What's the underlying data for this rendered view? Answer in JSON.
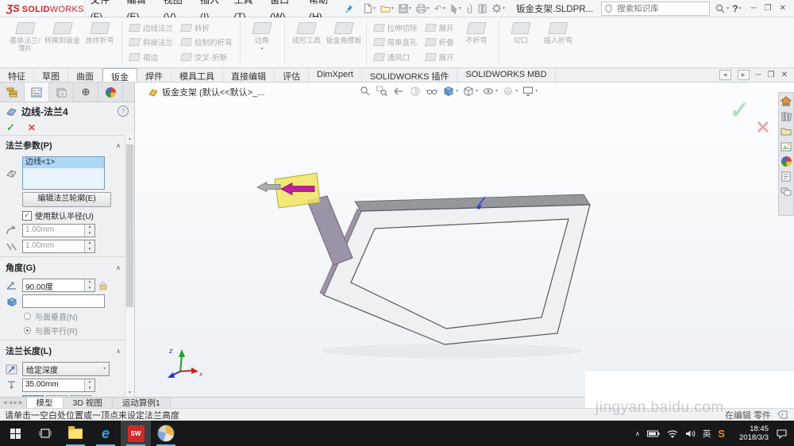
{
  "titlebar": {
    "logo_mark": "ƷS",
    "logo_solid": "SOLID",
    "logo_works": "WORKS",
    "menus": [
      "文件(F)",
      "编辑(E)",
      "视图(V)",
      "插入(I)",
      "工具(T)",
      "窗口(W)",
      "帮助(H)"
    ],
    "doc_title": "钣金支架.SLDPR...",
    "search_placeholder": "搜索知识库",
    "help_label": "?"
  },
  "icons": {
    "minimize": "─",
    "restore": "❐",
    "close": "✕",
    "caret": "▾",
    "chevron_up": "∧",
    "spin_up": "▲",
    "spin_down": "▼",
    "check": "✓",
    "cross": "✕",
    "nav_left": "◀",
    "nav_right": "▶",
    "target": "⊕",
    "undo": "↶",
    "tray_chevron": "∧"
  },
  "ribbon": {
    "big1": [
      "基体法兰/薄片",
      "转换到钣金",
      "放样折弯"
    ],
    "col1": [
      "边线法兰",
      "斜接法兰",
      "褶边"
    ],
    "col2": [
      "转折",
      "绘制的折弯",
      "交叉-折断"
    ],
    "corner": "边角",
    "big2": [
      "成形工具",
      "钣金角撑板"
    ],
    "col3": [
      "拉伸切除",
      "简单直孔",
      "通风口"
    ],
    "col4": [
      "展开",
      "折叠",
      "展开"
    ],
    "no_bends": "不折弯",
    "big3": [
      "切口",
      "插入折弯"
    ]
  },
  "feature_tabs": {
    "items": [
      "特征",
      "草图",
      "曲面",
      "钣金",
      "焊件",
      "模具工具",
      "直接编辑",
      "评估",
      "DimXpert",
      "SOLIDWORKS 插件",
      "SOLIDWORKS MBD"
    ]
  },
  "graphics": {
    "document_tab": "钣金支架 (默认<<默认>_..."
  },
  "property_panel": {
    "title": "边线-法兰4",
    "flange_params": {
      "header": "法兰参数(P)",
      "selection": "边线<1>",
      "edit_profile": "编辑法兰轮廓(E)",
      "use_default_radius": "使用默认半径(U)",
      "radius": "1.00mm",
      "gap_distance": "1.00mm"
    },
    "angle": {
      "header": "角度(G)",
      "value": "90.00度",
      "perpendicular": "与面垂直(N)",
      "parallel": "与面平行(R)"
    },
    "flange_length": {
      "header": "法兰长度(L)",
      "end_condition": "给定深度",
      "depth": "35.00mm"
    }
  },
  "model_tabs": {
    "items": [
      "模型",
      "3D 视图",
      "运动算例1"
    ]
  },
  "statusbar": {
    "message": "请单击一空白处位置或一顶点来设定法兰高度",
    "mode_text": "在编辑 零件",
    "watermark": "jingyan.baidu.com"
  },
  "taskbar": {
    "ime": "英",
    "time": "18:45",
    "date": "2018/3/3"
  }
}
